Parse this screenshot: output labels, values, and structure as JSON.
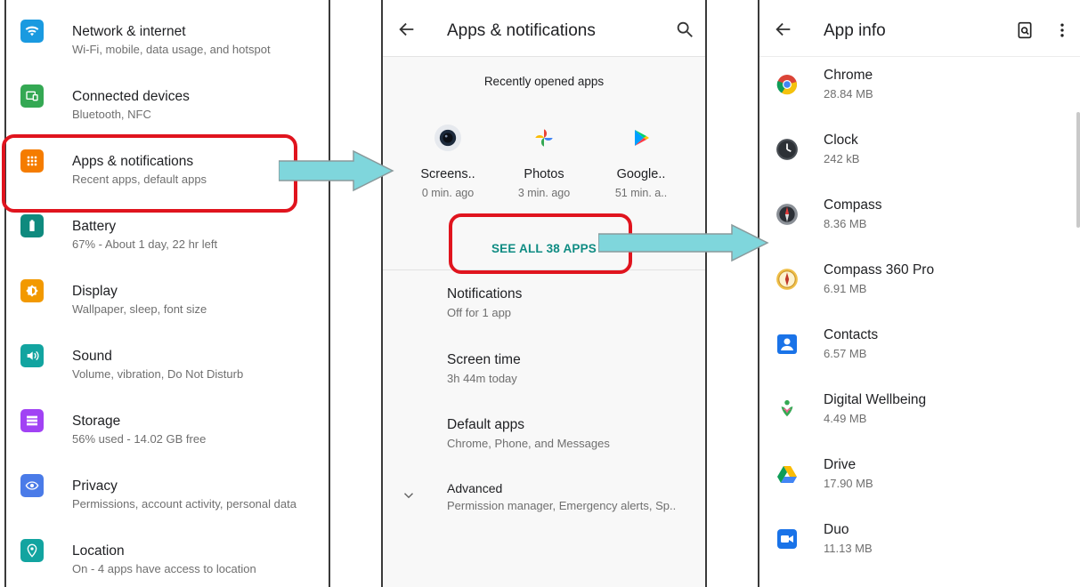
{
  "settings": {
    "items": [
      {
        "title": "Network & internet",
        "subtitle": "Wi-Fi, mobile, data usage, and hotspot",
        "icon": "wifi-icon",
        "color": "#1a9ae0"
      },
      {
        "title": "Connected devices",
        "subtitle": "Bluetooth, NFC",
        "icon": "devices-icon",
        "color": "#34a853"
      },
      {
        "title": "Apps & notifications",
        "subtitle": "Recent apps, default apps",
        "icon": "apps-grid-icon",
        "color": "#f57c00"
      },
      {
        "title": "Battery",
        "subtitle": "67% - About 1 day, 22 hr left",
        "icon": "battery-icon",
        "color": "#0f8a7e"
      },
      {
        "title": "Display",
        "subtitle": "Wallpaper, sleep, font size",
        "icon": "brightness-icon",
        "color": "#f29900"
      },
      {
        "title": "Sound",
        "subtitle": "Volume, vibration, Do Not Disturb",
        "icon": "volume-icon",
        "color": "#12a4a0"
      },
      {
        "title": "Storage",
        "subtitle": "56% used - 14.02 GB free",
        "icon": "storage-icon",
        "color": "#a142f4"
      },
      {
        "title": "Privacy",
        "subtitle": "Permissions, account activity, personal data",
        "icon": "privacy-eye-icon",
        "color": "#4a7be8"
      },
      {
        "title": "Location",
        "subtitle": "On - 4 apps have access to location",
        "icon": "location-pin-icon",
        "color": "#12a4a0"
      }
    ]
  },
  "apps_notifications": {
    "title": "Apps & notifications",
    "recent_label": "Recently opened apps",
    "recent_apps": [
      {
        "name": "Screens..",
        "time": "0 min. ago",
        "icon": "screen-recorder-icon"
      },
      {
        "name": "Photos",
        "time": "3 min. ago",
        "icon": "photos-pinwheel-icon"
      },
      {
        "name": "Google..",
        "time": "51 min. a..",
        "icon": "play-store-icon"
      }
    ],
    "see_all": "SEE ALL 38 APPS",
    "items": [
      {
        "title": "Notifications",
        "subtitle": "Off for 1 app"
      },
      {
        "title": "Screen time",
        "subtitle": "3h 44m today"
      },
      {
        "title": "Default apps",
        "subtitle": "Chrome, Phone, and Messages"
      },
      {
        "title": "Advanced",
        "subtitle": "Permission manager, Emergency alerts, Sp.."
      }
    ]
  },
  "app_info": {
    "title": "App info",
    "apps": [
      {
        "name": "Chrome",
        "size": "28.84 MB",
        "icon": "chrome-icon"
      },
      {
        "name": "Clock",
        "size": "242 kB",
        "icon": "clock-icon"
      },
      {
        "name": "Compass",
        "size": "8.36 MB",
        "icon": "compass-icon"
      },
      {
        "name": "Compass 360 Pro",
        "size": "6.91 MB",
        "icon": "compass-360-icon"
      },
      {
        "name": "Contacts",
        "size": "6.57 MB",
        "icon": "contacts-icon"
      },
      {
        "name": "Digital Wellbeing",
        "size": "4.49 MB",
        "icon": "wellbeing-icon"
      },
      {
        "name": "Drive",
        "size": "17.90 MB",
        "icon": "drive-icon"
      },
      {
        "name": "Duo",
        "size": "11.13 MB",
        "icon": "duo-icon"
      }
    ]
  },
  "colors": {
    "highlight": "#e0141e",
    "arrow": "#7fd6dc",
    "accent": "#0f8c83"
  }
}
